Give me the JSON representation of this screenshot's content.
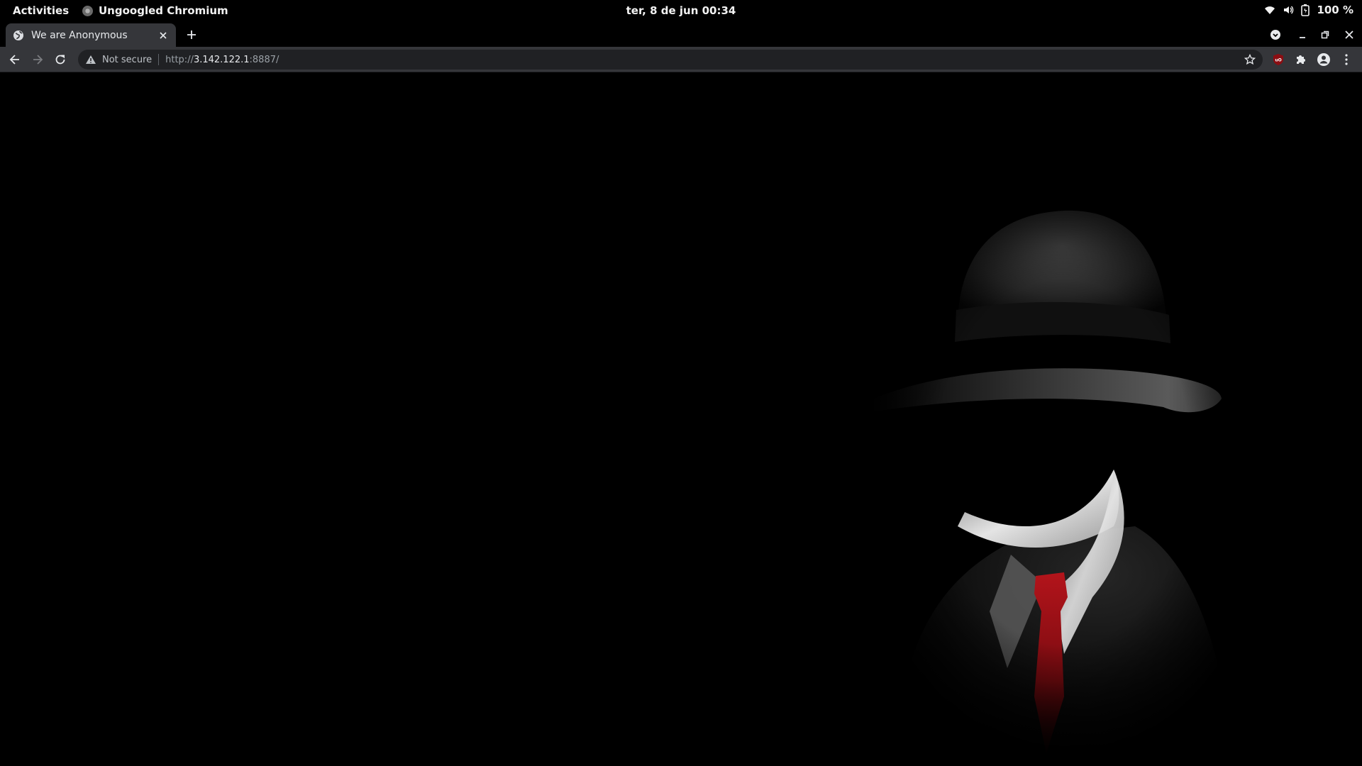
{
  "system": {
    "activities_label": "Activities",
    "app_name": "Ungoogled Chromium",
    "clock": "ter, 8 de jun  00:34",
    "battery": "100 %"
  },
  "browser": {
    "tab": {
      "title": "We are Anonymous"
    },
    "omnibox": {
      "security_label": "Not secure",
      "url_scheme": "http://",
      "url_host": "3.142.122.1",
      "url_rest": ":8887/"
    }
  },
  "icons": {
    "wifi": "wifi-icon",
    "volume": "volume-icon",
    "battery": "battery-icon",
    "back": "arrow-left-icon",
    "forward": "arrow-right-icon",
    "reload": "reload-icon",
    "star": "star-icon",
    "ublock": "ublock-icon",
    "extensions": "puzzle-icon",
    "profile": "profile-icon",
    "menu": "kebab-menu-icon"
  },
  "colors": {
    "page_background": "#000000",
    "toolbar": "#35363a",
    "omnibox": "#202124",
    "tie_red": "#a0141a"
  }
}
